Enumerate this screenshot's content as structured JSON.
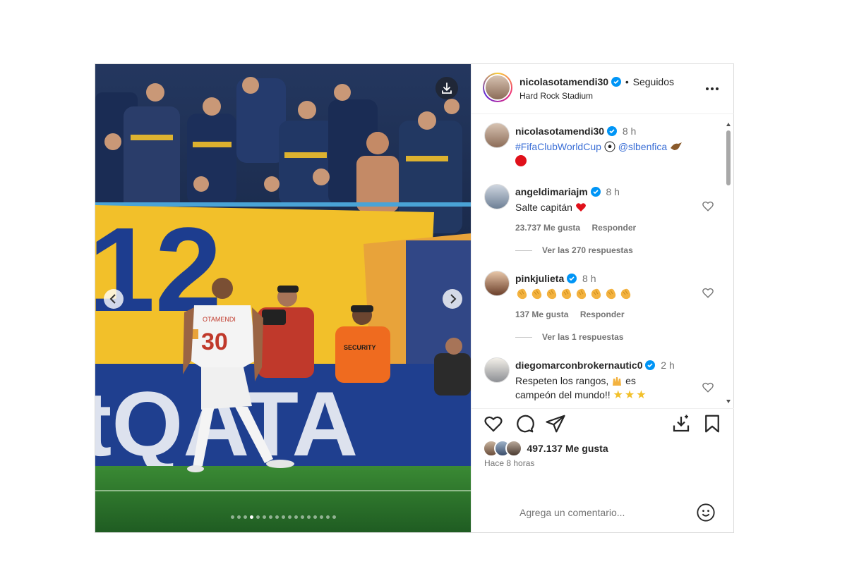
{
  "post": {
    "author": "nicolasotamendi30",
    "follow_separator": "•",
    "follow_status": "Seguidos",
    "location": "Hard Rock Stadium",
    "more_icon": "more-horizontal-icon",
    "media": {
      "description_colors": {
        "sky": "#1b2a4a",
        "banner_yellow": "#f2c02a",
        "banner_blue": "#1d3d8f",
        "pitch": "#2f7a2f"
      },
      "banner_text": "12",
      "board_text": "tQATA",
      "jersey_name": "OTAMENDI",
      "jersey_number": "30",
      "security_text": "SECURITY",
      "dots_count": 17,
      "active_dot": 3
    },
    "caption": {
      "user": "nicolasotamendi30",
      "time": "8 h",
      "hashtag": "#FifaClubWorldCup",
      "mention": "@slbenfica"
    },
    "comments": [
      {
        "user": "angeldimariajm",
        "time": "8 h",
        "text": "Salte capitán",
        "likes": "23.737 Me gusta",
        "reply_label": "Responder",
        "view_replies": "Ver las 270 respuestas"
      },
      {
        "user": "pinkjulieta",
        "time": "8 h",
        "text": "",
        "likes": "137 Me gusta",
        "reply_label": "Responder",
        "view_replies": "Ver las 1 respuestas"
      },
      {
        "user": "diegomarconbrokernautic0",
        "time": "2 h",
        "text_line1": "Respeten los rangos,",
        "text_line1b": "es",
        "text_line2": "campeón del mundo!!"
      }
    ],
    "likes_total": "497.137 Me gusta",
    "posted_ago": "Hace 8 horas",
    "comment_placeholder": "Agrega un comentario...",
    "accent_color": "#0095f6",
    "verified_color": "#0095f6"
  }
}
